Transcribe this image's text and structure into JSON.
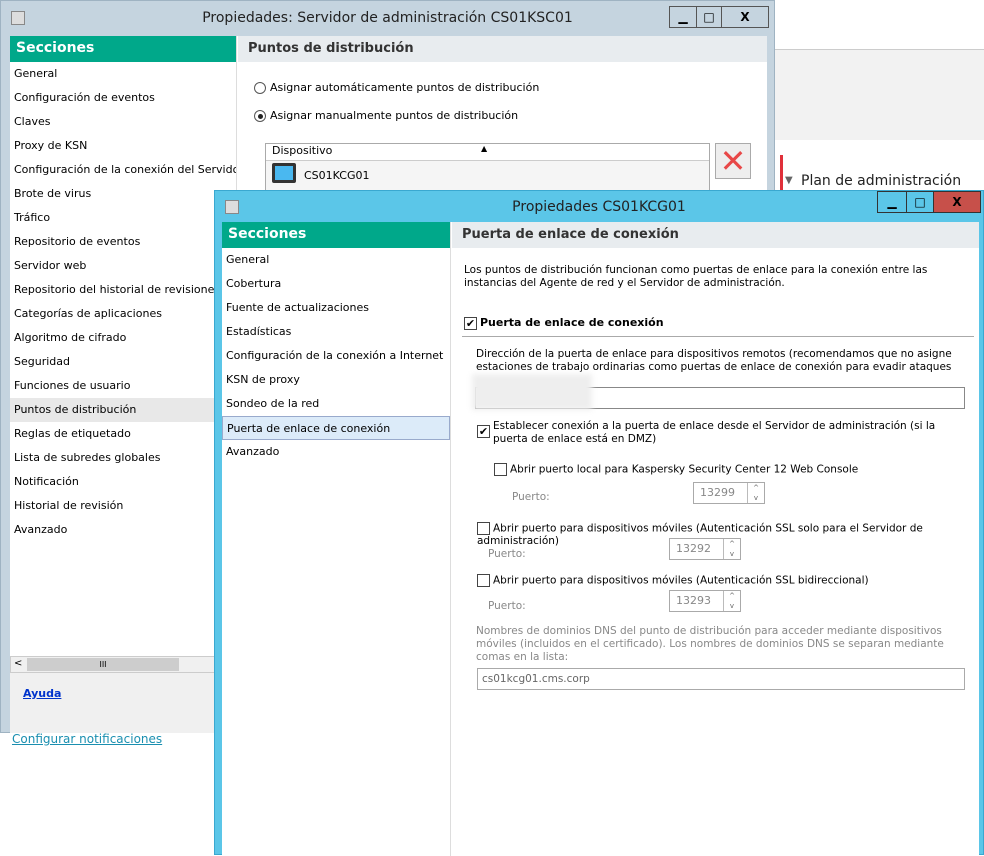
{
  "background": {
    "plan_label": "Plan de administración",
    "notif_link": "Configurar notificaciones"
  },
  "win1": {
    "title": "Propiedades: Servidor de administración CS01KSC01",
    "min": "▁",
    "max": "□",
    "close": "X",
    "sections_header": "Secciones",
    "sections": [
      "General",
      "Configuración de eventos",
      "Claves",
      "Proxy de KSN",
      "Configuración de la conexión del Servidor de administración",
      "Brote de virus",
      "Tráfico",
      "Repositorio de eventos",
      "Servidor web",
      "Repositorio del historial de revisiones",
      "Categorías de aplicaciones",
      "Algoritmo de cifrado",
      "Seguridad",
      "Funciones de usuario",
      "Puntos de distribución",
      "Reglas de etiquetado",
      "Lista de subredes globales",
      "Notificación",
      "Historial de revisión",
      "Avanzado"
    ],
    "selected": "Puntos de distribución",
    "page_title": "Puntos de distribución",
    "radio_auto": "Asignar automáticamente puntos de distribución",
    "radio_manual": "Asignar manualmente puntos de distribución",
    "table_header": "Dispositivo",
    "device": "CS01KCG01",
    "help": "Ayuda",
    "scroll_grip": "III"
  },
  "win2": {
    "title": "Propiedades CS01KCG01",
    "min": "▁",
    "max": "□",
    "close": "X",
    "sections_header": "Secciones",
    "sections": [
      "General",
      "Cobertura",
      "Fuente de actualizaciones",
      "Estadísticas",
      "Configuración de la conexión a Internet",
      "KSN de proxy",
      "Sondeo de la red",
      "Puerta de enlace de conexión",
      "Avanzado"
    ],
    "page_title": "Puerta de enlace de conexión",
    "intro": "Los puntos de distribución funcionan como puertas de enlace para la conexión entre las instancias del Agente de red y el Servidor de administración.",
    "gateway_checkbox": "Puerta de enlace de conexión",
    "address_label": "Dirección de la puerta de enlace para dispositivos remotos (recomendamos que no asigne estaciones de trabajo ordinarias como puertas de enlace de conexión para evadir ataques de delincuentes informáticos):",
    "establish_label": "Establecer conexión a la puerta de enlace desde el Servidor de administración (si la puerta de enlace está en DMZ)",
    "web_console_label": "Abrir puerto local para Kaspersky Security Center 12 Web Console",
    "port_label": "Puerto:",
    "port_web": "13299",
    "mobile_ssl_label": "Abrir puerto para dispositivos móviles (Autenticación SSL solo para el Servidor de administración)",
    "port_mobile_ssl": "13292",
    "mobile_bidir_label": "Abrir puerto para dispositivos móviles (Autenticación SSL bidireccional)",
    "port_mobile_bidir": "13293",
    "dns_label": "Nombres de dominios DNS del punto de distribución para acceder mediante dispositivos móviles (incluidos en el certificado). Los nombres de dominios DNS se separan mediante comas en la lista:",
    "dns_value": "cs01kcg01.cms.corp"
  }
}
